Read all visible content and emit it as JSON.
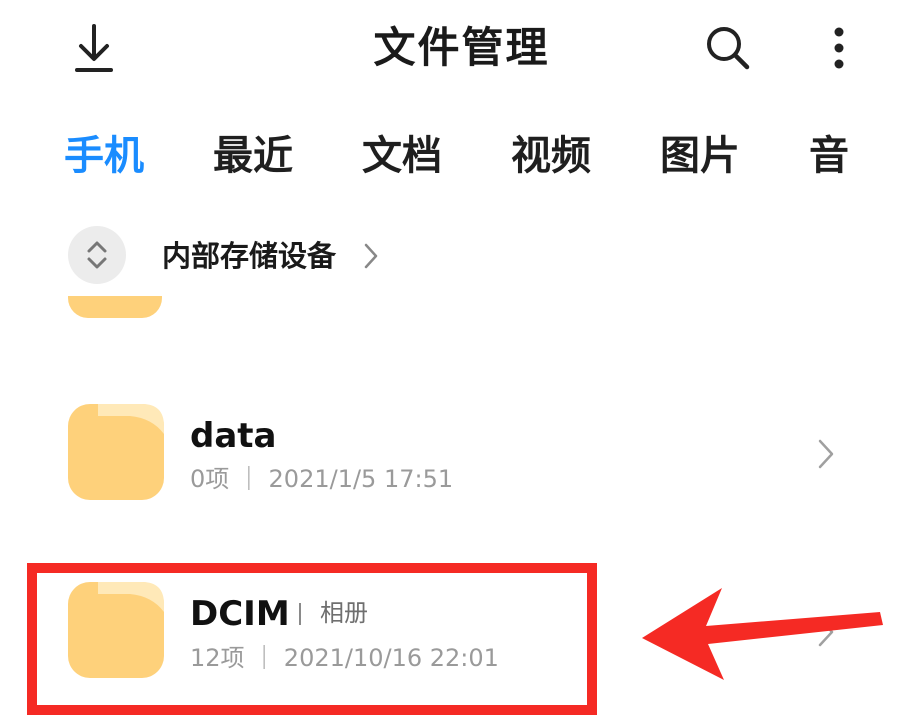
{
  "header": {
    "title": "文件管理",
    "icons": {
      "download": "download-icon",
      "search": "search-icon",
      "more": "more-vertical-icon"
    }
  },
  "tabs": [
    {
      "label": "手机",
      "active": true
    },
    {
      "label": "最近",
      "active": false
    },
    {
      "label": "文档",
      "active": false
    },
    {
      "label": "视频",
      "active": false
    },
    {
      "label": "图片",
      "active": false
    },
    {
      "label": "音",
      "active": false
    }
  ],
  "storage": {
    "label": "内部存储设备"
  },
  "folders": [
    {
      "name": "data",
      "meta": "0项 ｜ 2021/1/5 17:51"
    },
    {
      "name": "DCIM",
      "tag": "相册",
      "meta": "12项 ｜ 2021/10/16 22:01"
    }
  ],
  "colors": {
    "accent": "#1a8cff",
    "folder": "#fed17b",
    "folder_tab": "#ffe9b8",
    "annotation": "#f52a24"
  }
}
